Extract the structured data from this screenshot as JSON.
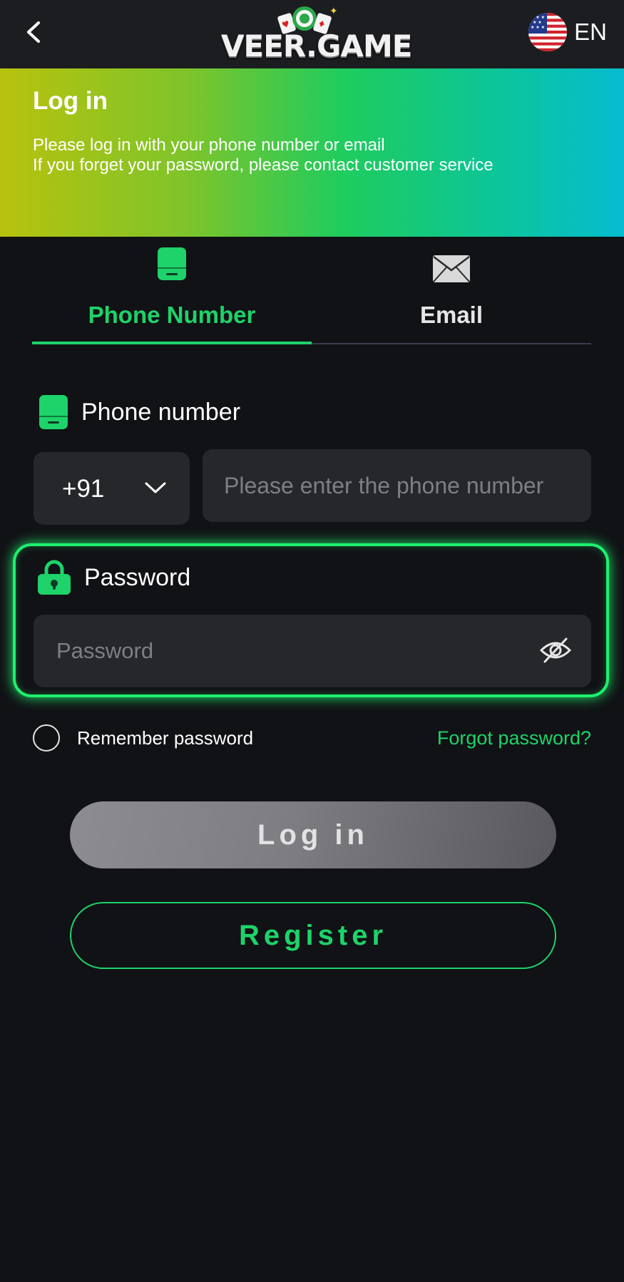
{
  "header": {
    "logo_text": "VEER.GAME",
    "language": "EN"
  },
  "banner": {
    "title": "Log in",
    "line1": "Please log in with your phone number or email",
    "line2": "If you forget your password, please contact customer service"
  },
  "tabs": [
    {
      "label": "Phone Number",
      "active": true,
      "icon": "phone-icon"
    },
    {
      "label": "Email",
      "active": false,
      "icon": "envelope-icon"
    }
  ],
  "phone": {
    "label": "Phone number",
    "country_code": "+91",
    "placeholder": "Please enter the phone number"
  },
  "password": {
    "label": "Password",
    "placeholder": "Password"
  },
  "remember_label": "Remember password",
  "forgot_label": "Forgot password?",
  "login_label": "Log in",
  "register_label": "Register",
  "colors": {
    "accent": "#1dd36a",
    "background": "#111215",
    "input_bg": "#26272b"
  }
}
